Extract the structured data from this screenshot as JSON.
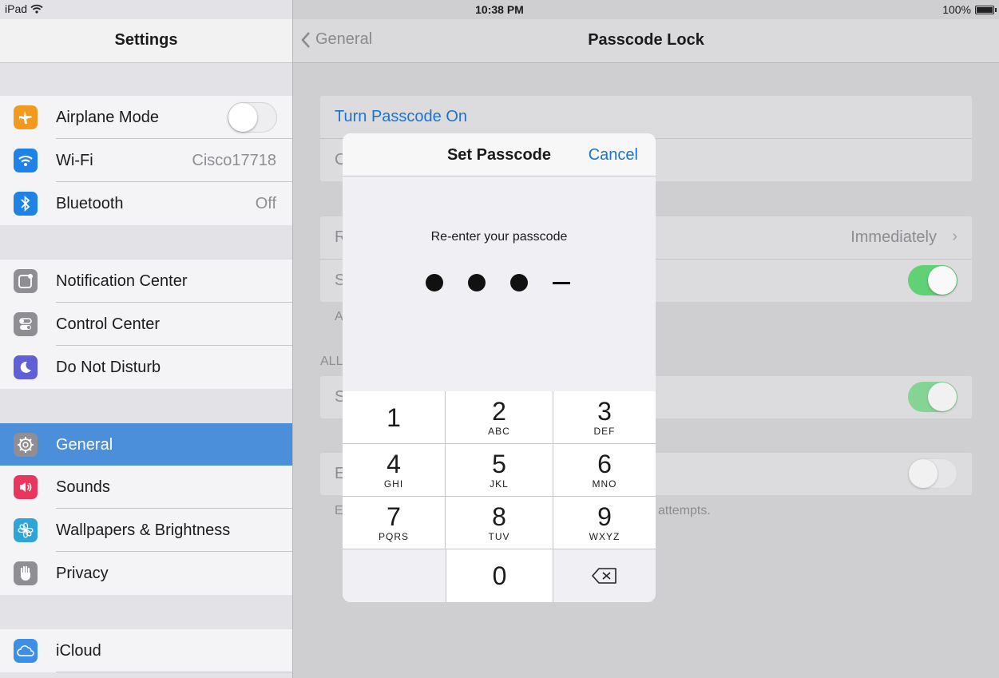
{
  "status": {
    "device": "iPad",
    "time": "10:38 PM",
    "battery": "100%"
  },
  "left": {
    "title": "Settings",
    "items": [
      {
        "label": "Airplane Mode",
        "icon": "airplane-icon",
        "color": "#f29a1e",
        "toggle": "off"
      },
      {
        "label": "Wi-Fi",
        "icon": "wifi-icon",
        "color": "#1e82e6",
        "value": "Cisco17718"
      },
      {
        "label": "Bluetooth",
        "icon": "bluetooth-icon",
        "color": "#1e82e6",
        "value": "Off"
      },
      {
        "label": "Notification Center",
        "icon": "notification-icon",
        "color": "#8e8e93"
      },
      {
        "label": "Control Center",
        "icon": "control-center-icon",
        "color": "#8e8e93"
      },
      {
        "label": "Do Not Disturb",
        "icon": "moon-icon",
        "color": "#5f5fd6"
      },
      {
        "label": "General",
        "icon": "gear-icon",
        "color": "#8e8e93",
        "selected": true
      },
      {
        "label": "Sounds",
        "icon": "speaker-icon",
        "color": "#e8365c"
      },
      {
        "label": "Wallpapers & Brightness",
        "icon": "flower-icon",
        "color": "#2fa4d8"
      },
      {
        "label": "Privacy",
        "icon": "hand-icon",
        "color": "#8e8e93"
      },
      {
        "label": "iCloud",
        "icon": "cloud-icon",
        "color": "#3c8ee6"
      }
    ]
  },
  "right": {
    "back_label": "General",
    "title": "Passcode Lock",
    "turn_passcode_on": "Turn Passcode On",
    "change_initial": "C",
    "require_initial": "R",
    "require_value": "Immediately",
    "simple_initial": "S",
    "a_initial": "A",
    "allow_initial": "ALL",
    "s2_initial": "S",
    "erase_initial": "E",
    "erase_note_initial": "E",
    "attempts_text": "attempts."
  },
  "dialog": {
    "title": "Set Passcode",
    "cancel": "Cancel",
    "prompt": "Re-enter your passcode",
    "filled_digits": 3,
    "total_digits": 4,
    "keys": [
      {
        "num": "1",
        "letters": ""
      },
      {
        "num": "2",
        "letters": "ABC"
      },
      {
        "num": "3",
        "letters": "DEF"
      },
      {
        "num": "4",
        "letters": "GHI"
      },
      {
        "num": "5",
        "letters": "JKL"
      },
      {
        "num": "6",
        "letters": "MNO"
      },
      {
        "num": "7",
        "letters": "PQRS"
      },
      {
        "num": "8",
        "letters": "TUV"
      },
      {
        "num": "9",
        "letters": "WXYZ"
      },
      {
        "num": "0",
        "letters": ""
      }
    ]
  }
}
